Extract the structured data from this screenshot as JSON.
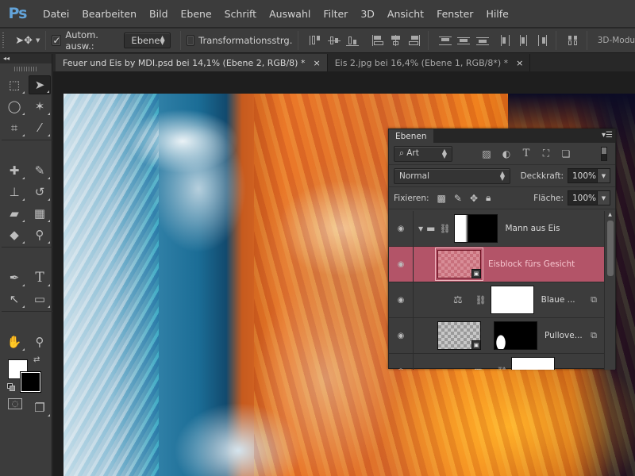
{
  "app": {
    "logo": "Ps",
    "name": "Adobe Photoshop"
  },
  "menu": [
    "Datei",
    "Bearbeiten",
    "Bild",
    "Ebene",
    "Schrift",
    "Auswahl",
    "Filter",
    "3D",
    "Ansicht",
    "Fenster",
    "Hilfe"
  ],
  "options": {
    "tool_icon": "move-tool-icon",
    "auto_select_checked": true,
    "auto_select_label": "Autom. ausw.:",
    "auto_select_target": "Ebene",
    "transform_checked": false,
    "transform_label": "Transformationsstrg.",
    "mode_3d_label": "3D-Modu"
  },
  "tabs": [
    {
      "label": "Feuer und Eis by MDI.psd bei 14,1% (Ebene 2, RGB/8) *",
      "active": true,
      "close": "×"
    },
    {
      "label": "Eis 2.jpg bei 16,4% (Ebene 1, RGB/8*) *",
      "active": false,
      "close": "×"
    }
  ],
  "toolbox": {
    "collapse": "◂◂",
    "tools": [
      {
        "name": "marquee",
        "glyph": "⬚"
      },
      {
        "name": "move",
        "glyph": "➤"
      },
      {
        "name": "lasso",
        "glyph": "◯"
      },
      {
        "name": "magic-wand",
        "glyph": "✶"
      },
      {
        "name": "crop",
        "glyph": "⌗"
      },
      {
        "name": "eyedropper",
        "glyph": "⁄"
      },
      {
        "name": "healing-brush",
        "glyph": "✚"
      },
      {
        "name": "brush",
        "glyph": "✎"
      },
      {
        "name": "clone-stamp",
        "glyph": "⊥"
      },
      {
        "name": "history-brush",
        "glyph": "↺"
      },
      {
        "name": "eraser",
        "glyph": "▰"
      },
      {
        "name": "gradient",
        "glyph": "▦"
      },
      {
        "name": "blur",
        "glyph": "◆"
      },
      {
        "name": "dodge",
        "glyph": "⚲"
      },
      {
        "name": "pen",
        "glyph": "✒"
      },
      {
        "name": "type",
        "glyph": "T"
      },
      {
        "name": "path-selection",
        "glyph": "↖"
      },
      {
        "name": "rectangle",
        "glyph": "▭"
      },
      {
        "name": "hand",
        "glyph": "✋"
      },
      {
        "name": "zoom",
        "glyph": "⚲"
      }
    ],
    "foreground_color": "#ffffff",
    "background_color": "#000000",
    "quick_mask": "◌",
    "screen_mode": "❐"
  },
  "layers_panel": {
    "tab": "Ebenen",
    "filter_type": "Art",
    "blend_mode": "Normal",
    "opacity_label": "Deckkraft:",
    "opacity_value": "100%",
    "lock_label": "Fixieren:",
    "fill_label": "Fläche:",
    "fill_value": "100%",
    "layers": [
      {
        "name": "Mann aus Eis",
        "type": "group",
        "visible": true,
        "selected": false
      },
      {
        "name": "Eisblock fürs Gesicht",
        "type": "smart-object",
        "visible": true,
        "selected": true
      },
      {
        "name": "Blaue ...",
        "type": "adjustment-color-balance",
        "visible": true,
        "selected": false,
        "clipped": true
      },
      {
        "name": "Pullove...",
        "type": "smart-object-masked",
        "visible": true,
        "selected": false,
        "clipped": true
      },
      {
        "name": "",
        "type": "adjustment-levels",
        "visible": true,
        "selected": false
      }
    ],
    "selected_color": "#b35468"
  }
}
